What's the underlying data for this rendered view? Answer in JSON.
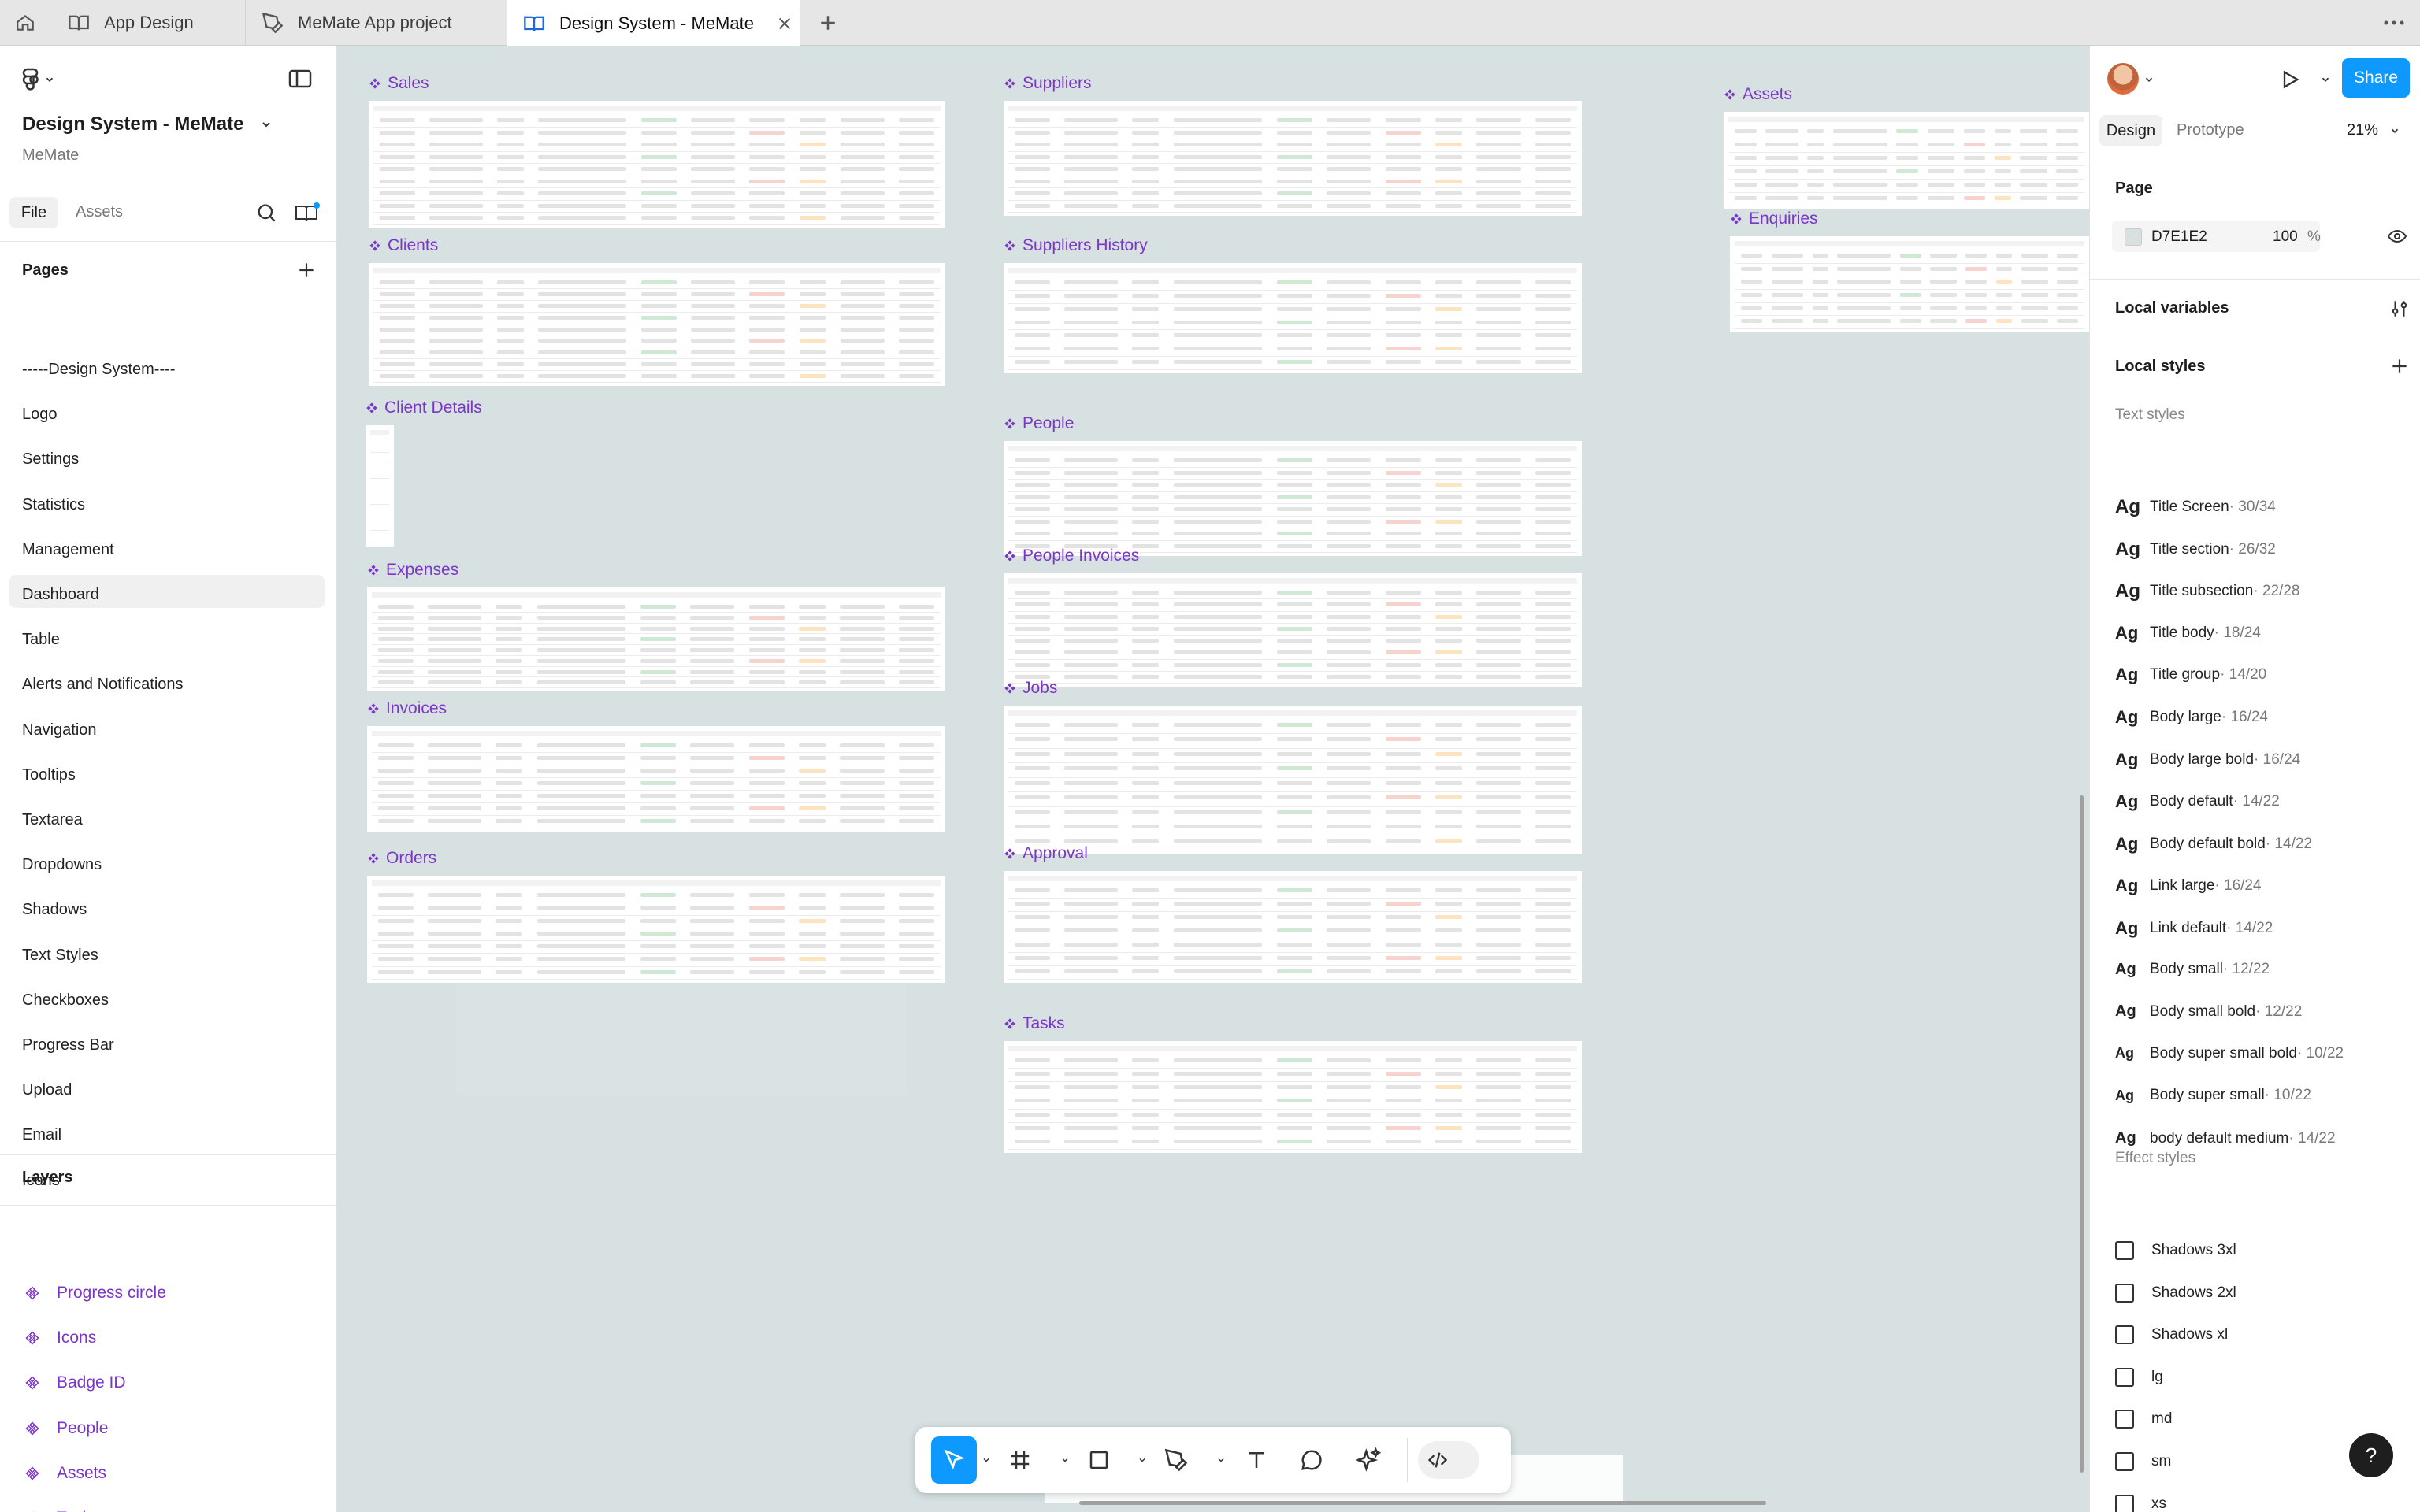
{
  "tabs": [
    {
      "label": "App Design"
    },
    {
      "label": "MeMate App project"
    },
    {
      "label": "Design System - MeMate"
    }
  ],
  "file": {
    "title": "Design System - MeMate",
    "team": "MeMate"
  },
  "left_tabs": {
    "file": "File",
    "assets": "Assets"
  },
  "pages": {
    "heading": "Pages",
    "items": [
      "-----Design System----",
      "Logo",
      "Settings",
      "Statistics",
      "Management",
      "Dashboard",
      "Table",
      "Alerts and Notifications",
      "Navigation",
      "Tooltips",
      "Textarea",
      "Dropdowns",
      "Shadows",
      "Text Styles",
      "Checkboxes",
      "Progress Bar",
      "Upload",
      "Email",
      "Icons"
    ],
    "selected": "Table"
  },
  "layers": {
    "heading": "Layers",
    "items": [
      "Progress circle",
      "Icons",
      "Badge ID",
      "People",
      "Assets",
      "Tasks"
    ]
  },
  "right": {
    "share": "Share",
    "tabs": {
      "design": "Design",
      "prototype": "Prototype"
    },
    "zoom": "21%",
    "page_section": "Page",
    "bg_hex": "D7E1E2",
    "bg_opacity": "100",
    "bg_percent": "%",
    "local_variables": "Local variables",
    "local_styles": "Local styles",
    "text_styles_heading": "Text styles",
    "text_styles": [
      {
        "ag": "Ag",
        "name": "Title Screen",
        "meta": " · 30/34"
      },
      {
        "ag": "Ag",
        "name": "Title section",
        "meta": " · 26/32"
      },
      {
        "ag": "Ag",
        "name": "Title subsection",
        "meta": " · 22/28"
      },
      {
        "ag": "Ag",
        "name": "Title body",
        "meta": " · 18/24"
      },
      {
        "ag": "Ag",
        "name": "Title group",
        "meta": " · 14/20"
      },
      {
        "ag": "Ag",
        "name": "Body large",
        "meta": " · 16/24"
      },
      {
        "ag": "Ag",
        "name": "Body large bold",
        "meta": " · 16/24"
      },
      {
        "ag": "Ag",
        "name": "Body default",
        "meta": " · 14/22"
      },
      {
        "ag": "Ag",
        "name": "Body default bold",
        "meta": " · 14/22"
      },
      {
        "ag": "Ag",
        "name": "Link large",
        "meta": " · 16/24"
      },
      {
        "ag": "Ag",
        "name": "Link default",
        "meta": " · 14/22"
      },
      {
        "ag": "Ag",
        "name": "Body small",
        "meta": " · 12/22"
      },
      {
        "ag": "Ag",
        "name": "Body small bold",
        "meta": " · 12/22"
      },
      {
        "ag": "Ag",
        "name": "Body super small bold",
        "meta": " · 10/22"
      },
      {
        "ag": "Ag",
        "name": "Body super small",
        "meta": " · 10/22"
      },
      {
        "ag": "Ag",
        "name": "body default medium",
        "meta": " · 14/22"
      }
    ],
    "effect_styles_heading": "Effect styles",
    "effect_styles": [
      "Shadows 3xl",
      "Shadows 2xl",
      "Shadows xl",
      "lg",
      "md",
      "sm",
      "xs"
    ]
  },
  "frames": [
    {
      "title": "Sales"
    },
    {
      "title": "Clients"
    },
    {
      "title": "Client Details"
    },
    {
      "title": "Expenses"
    },
    {
      "title": "Invoices"
    },
    {
      "title": "Orders"
    },
    {
      "title": "Suppliers"
    },
    {
      "title": "Suppliers History"
    },
    {
      "title": "People"
    },
    {
      "title": "People Invoices"
    },
    {
      "title": "Jobs"
    },
    {
      "title": "Approval"
    },
    {
      "title": "Tasks"
    },
    {
      "title": "Assets"
    },
    {
      "title": "Enquiries"
    }
  ],
  "help": "?"
}
